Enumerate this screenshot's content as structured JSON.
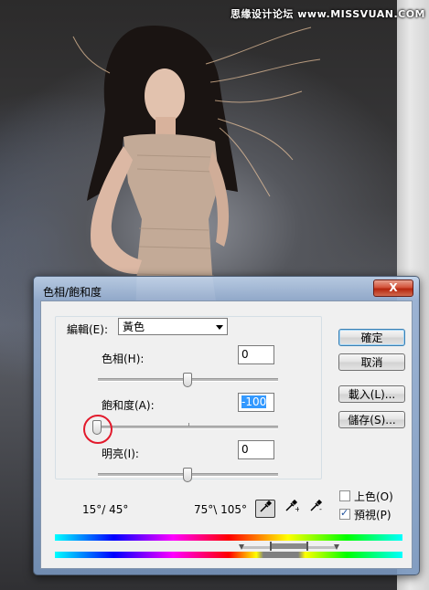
{
  "watermark": "思缘设计论坛 www.MISSVUAN.COM",
  "dialog": {
    "title": "色相/飽和度",
    "close_label": "X",
    "edit_label": "編輯(E):",
    "edit_value": "黃色",
    "hue": {
      "label": "色相(H):",
      "value": "0",
      "slider_fraction": 0.5
    },
    "saturation": {
      "label": "飽和度(A):",
      "value": "-100",
      "slider_fraction": 0.0
    },
    "lightness": {
      "label": "明亮(I):",
      "value": "0",
      "slider_fraction": 0.5
    },
    "buttons": {
      "ok": "確定",
      "cancel": "取消",
      "load": "載入(L)...",
      "save": "儲存(S)..."
    },
    "colorize": {
      "label": "上色(O)",
      "checked": false
    },
    "preview": {
      "label": "預視(P)",
      "checked": true
    },
    "range_left": "15°/ 45°",
    "range_right": "75°\\ 105°",
    "eyedroppers": [
      "eyedropper-icon",
      "eyedropper-plus-icon",
      "eyedropper-minus-icon"
    ]
  },
  "colors": {
    "highlight": "#3399ff",
    "circle": "#e21a2c"
  }
}
